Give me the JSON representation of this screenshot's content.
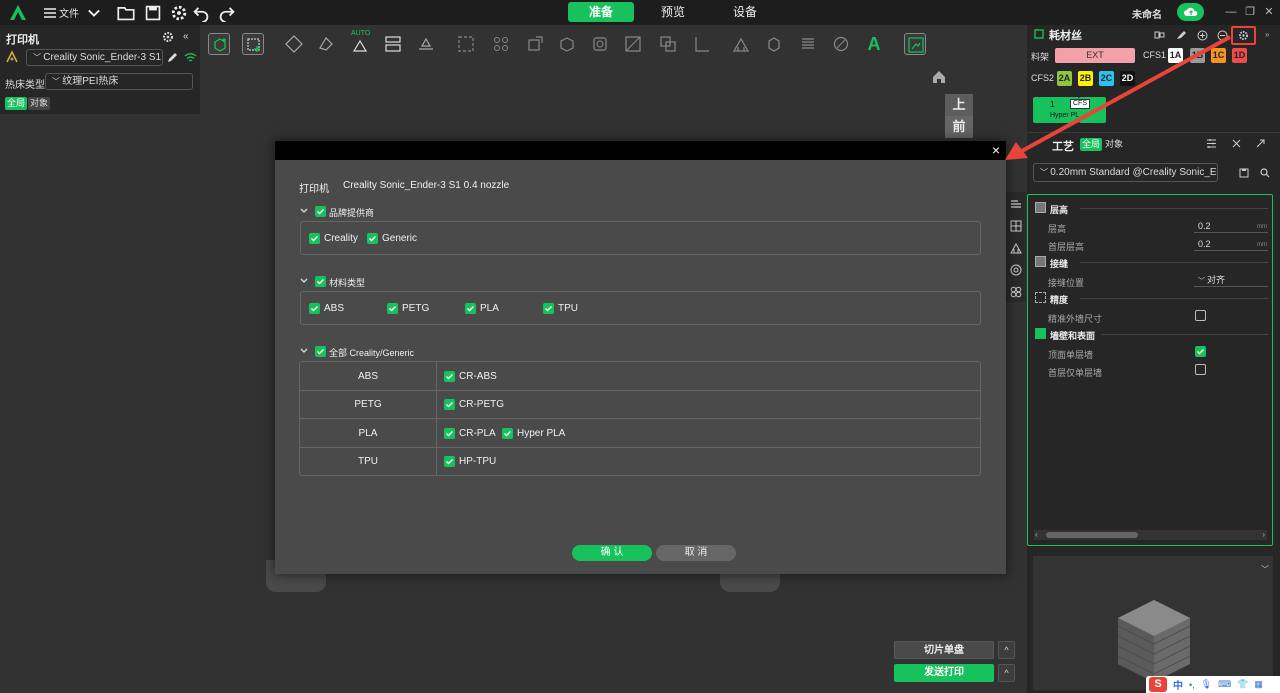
{
  "topbar": {
    "file_label": "文件",
    "tabs": [
      {
        "label": "准备",
        "active": true
      },
      {
        "label": "预览",
        "active": false
      },
      {
        "label": "设备",
        "active": false
      }
    ],
    "project_name": "未命名"
  },
  "left_panel": {
    "title": "打印机",
    "printer": "Creality Sonic_Ender-3 S1 0...",
    "bed_type_label": "热床类型",
    "bed_type_value": "纹理PEI热床",
    "scope_global": "全局",
    "scope_object": "对象"
  },
  "toolbar": {
    "auto_badge": "AUTO",
    "text_tool": "A"
  },
  "viewcube": {
    "top": "上",
    "front": "前"
  },
  "modal": {
    "close_glyph": "×",
    "printer_label": "打印机",
    "printer_value": "Creality Sonic_Ender-3 S1 0.4 nozzle",
    "vendors": {
      "title": "品牌提供商",
      "items": [
        "Creality",
        "Generic"
      ]
    },
    "types": {
      "title": "材料类型",
      "items": [
        "ABS",
        "PETG",
        "PLA",
        "TPU"
      ]
    },
    "all": {
      "title": "全部 Creality/Generic",
      "rows": [
        {
          "type": "ABS",
          "items": [
            "CR-ABS"
          ]
        },
        {
          "type": "PETG",
          "items": [
            "CR-PETG"
          ]
        },
        {
          "type": "PLA",
          "items": [
            "CR-PLA",
            "Hyper PLA"
          ]
        },
        {
          "type": "TPU",
          "items": [
            "HP-TPU"
          ]
        }
      ]
    },
    "confirm": "确 认",
    "cancel": "取 消"
  },
  "right_panel": {
    "filament_title": "耗材丝",
    "material_label": "料架",
    "ext_label": "EXT",
    "cfs1_label": "CFS1",
    "cfs1_slots": [
      {
        "label": "1A",
        "color": "#ffffff"
      },
      {
        "label": "1B",
        "color": "#9a9a9a"
      },
      {
        "label": "1C",
        "color": "#f7941d"
      },
      {
        "label": "1D",
        "color": "#ef4b4b"
      }
    ],
    "cfs2_label": "CFS2",
    "cfs2_slots": [
      {
        "label": "2A",
        "color": "#8dc63f"
      },
      {
        "label": "2B",
        "color": "#fff200"
      },
      {
        "label": "2C",
        "color": "#29c4f0"
      },
      {
        "label": "2D",
        "color": "#111111"
      }
    ],
    "filament_card_num": "1",
    "filament_card_tag": "CFS",
    "filament_card_name": "Hyper PLA",
    "process_title": "工艺",
    "process_global": "全局",
    "process_object": "对象",
    "process_preset": "0.20mm Standard @Creality Sonic_Ender...",
    "groups": [
      {
        "title": "层高",
        "props": [
          {
            "label": "层高",
            "value": "0.2",
            "unit": "mm"
          },
          {
            "label": "首层层高",
            "value": "0.2",
            "unit": "mm"
          }
        ]
      },
      {
        "title": "接缝",
        "props": [
          {
            "label": "接缝位置",
            "value": "对齐"
          }
        ]
      },
      {
        "title": "精度",
        "props": [
          {
            "label": "精准外墙尺寸",
            "checked": false
          }
        ]
      },
      {
        "title": "墙壁和表面",
        "props": [
          {
            "label": "顶面单层墙",
            "checked": true
          },
          {
            "label": "首层仅单层墙",
            "checked": false
          }
        ]
      }
    ]
  },
  "actions": {
    "slice_plate": "切片单盘",
    "send_print": "发送打印"
  },
  "taskbar": {
    "ime": "中"
  },
  "colors": {
    "accent": "#17c15b",
    "annotation": "#e8443a"
  }
}
